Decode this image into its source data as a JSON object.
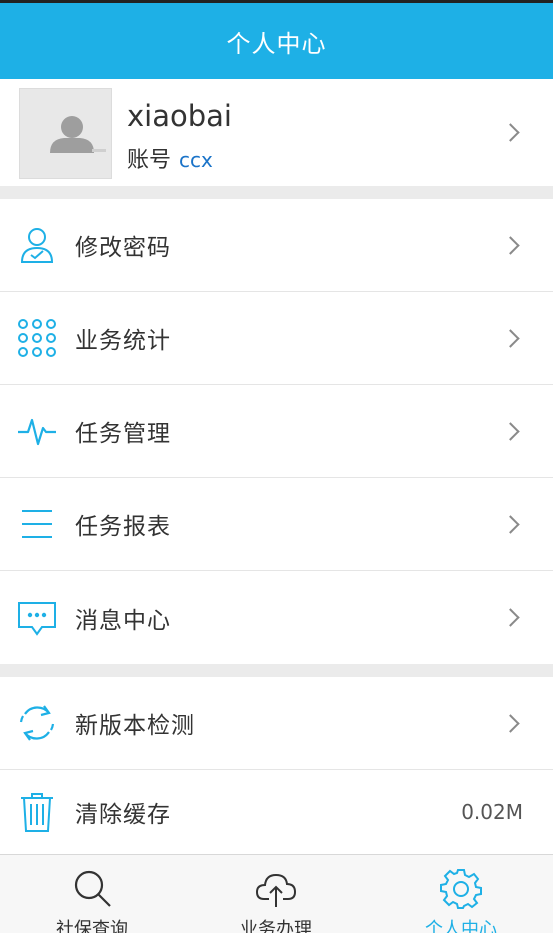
{
  "header": {
    "title": "个人中心"
  },
  "profile": {
    "name": "xiaobai",
    "account_label": "账号",
    "account_value": "ccx",
    "avatar_icon": "person-placeholder-icon"
  },
  "menu_group1": [
    {
      "label": "修改密码",
      "icon": "user-check-icon"
    },
    {
      "label": "业务统计",
      "icon": "dot-grid-icon"
    },
    {
      "label": "任务管理",
      "icon": "pulse-icon"
    },
    {
      "label": "任务报表",
      "icon": "list-lines-icon"
    },
    {
      "label": "消息中心",
      "icon": "message-icon"
    }
  ],
  "menu_group2": [
    {
      "label": "新版本检测",
      "icon": "refresh-icon"
    },
    {
      "label": "清除缓存",
      "icon": "trash-icon",
      "value": "0.02M"
    }
  ],
  "tabbar": [
    {
      "label": "社保查询",
      "icon": "search-icon",
      "active": false
    },
    {
      "label": "业务办理",
      "icon": "cloud-upload-icon",
      "active": false
    },
    {
      "label": "个人中心",
      "icon": "gear-icon",
      "active": true
    }
  ],
  "colors": {
    "accent": "#1eb0e6",
    "link": "#1a73c8",
    "divider": "#ebebeb"
  }
}
